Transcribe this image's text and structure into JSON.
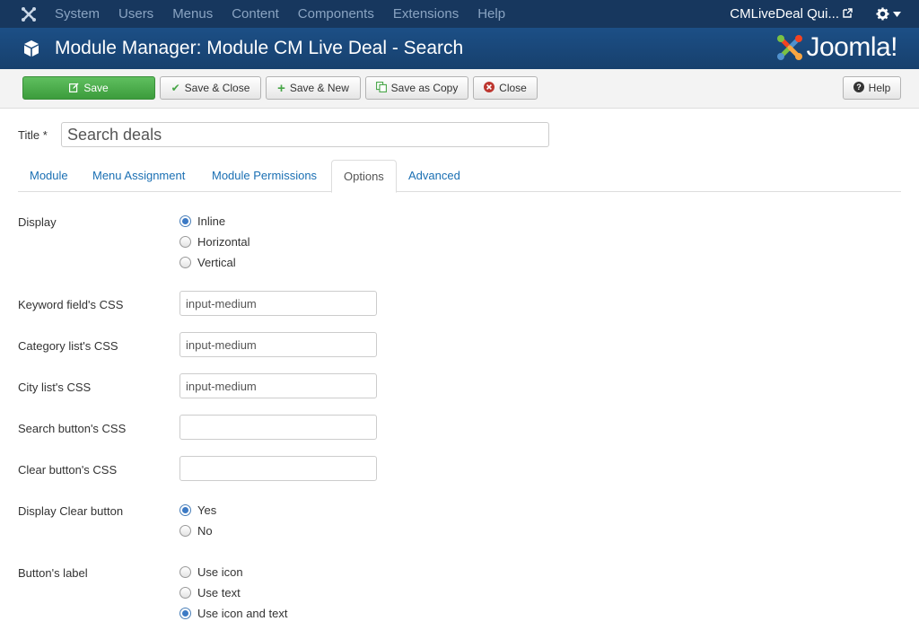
{
  "topnav": {
    "menu": [
      "System",
      "Users",
      "Menus",
      "Content",
      "Components",
      "Extensions",
      "Help"
    ],
    "site_name": "CMLiveDeal Qui..."
  },
  "header": {
    "title": "Module Manager: Module CM Live Deal - Search",
    "brand": "Joomla!"
  },
  "toolbar": {
    "save": "Save",
    "save_close": "Save & Close",
    "save_new": "Save & New",
    "save_copy": "Save as Copy",
    "close": "Close",
    "help": "Help"
  },
  "title_field": {
    "label": "Title *",
    "value": "Search deals"
  },
  "tabs": [
    "Module",
    "Menu Assignment",
    "Module Permissions",
    "Options",
    "Advanced"
  ],
  "active_tab": "Options",
  "form": {
    "display": {
      "label": "Display",
      "options": [
        "Inline",
        "Horizontal",
        "Vertical"
      ],
      "selected": "Inline"
    },
    "keyword_css": {
      "label": "Keyword field's CSS",
      "value": "input-medium"
    },
    "category_css": {
      "label": "Category list's CSS",
      "value": "input-medium"
    },
    "city_css": {
      "label": "City list's CSS",
      "value": "input-medium"
    },
    "search_button_css": {
      "label": "Search button's CSS",
      "value": ""
    },
    "clear_button_css": {
      "label": "Clear button's CSS",
      "value": ""
    },
    "display_clear": {
      "label": "Display Clear button",
      "options": [
        "Yes",
        "No"
      ],
      "selected": "Yes"
    },
    "button_label": {
      "label": "Button's label",
      "options": [
        "Use icon",
        "Use text",
        "Use icon and text"
      ],
      "selected": "Use icon and text"
    }
  },
  "colors": {
    "nav_bg": "#17375e",
    "header_bg": "#1c4f86",
    "save_green": "#46a546",
    "link_blue": "#1a6fb3",
    "radio_selected": "#3c7ac5"
  }
}
